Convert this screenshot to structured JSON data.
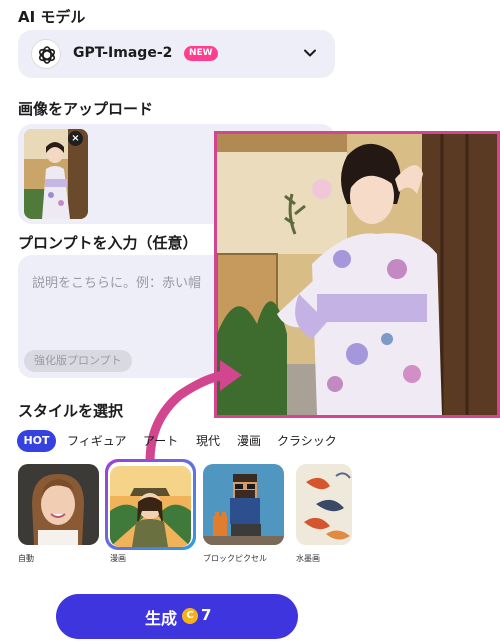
{
  "model_section": {
    "label": "AI モデル",
    "selected_model": "GPT-Image-2",
    "badge": "NEW",
    "icon": "openai-logo-icon"
  },
  "upload_section": {
    "label": "画像をアップロード",
    "remove_icon": "×"
  },
  "prompt_section": {
    "label": "プロンプトを入力（任意）",
    "placeholder": "説明をこちらに。例：赤い帽",
    "enhance_button": "強化版プロンプト"
  },
  "style_section": {
    "label": "スタイルを選択",
    "tabs": [
      "HOT",
      "フィギュア",
      "アート",
      "現代",
      "漫画",
      "クラシック"
    ],
    "active_tab": "HOT",
    "cards": [
      {
        "label": "自動",
        "selected": false
      },
      {
        "label": "漫画",
        "selected": true
      },
      {
        "label": "ブロックピクセル",
        "selected": false
      },
      {
        "label": "水墨画",
        "selected": false
      }
    ]
  },
  "generate_button": {
    "label": "生成",
    "coin_symbol": "C",
    "cost": "7"
  },
  "colors": {
    "accent": "#3e35de",
    "hot_tab": "#3642e0",
    "new_badge": "#ff3e8f",
    "panel_bg": "#eeeef8",
    "highlight_arrow": "#d2458f"
  }
}
